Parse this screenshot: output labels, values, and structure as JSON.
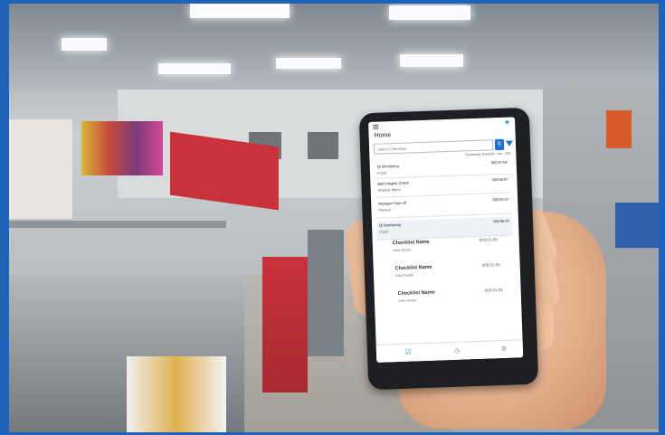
{
  "app": {
    "header_title": "Home",
    "search_placeholder": "Search Checklists",
    "remaining_text": "Remaining Time(HH : mm : SS)",
    "tasks": [
      {
        "name": "QI Monitoring",
        "time": "000:07:08",
        "area": "Foyer"
      },
      {
        "name": "Bell Integrity Check",
        "time": "000:08:07",
        "area": "Regular Menu"
      },
      {
        "name": "Manager Sign-off",
        "time": "000:08:47",
        "area": "Manual"
      },
      {
        "name": "QI Monitoring",
        "time": "000:08:47",
        "area": "Foyer"
      }
    ],
    "checklists": [
      {
        "name": "Checklist Name",
        "area": "Area Name",
        "time": "000:01:05"
      },
      {
        "name": "Checklist Name",
        "area": "Area Name",
        "time": "000:01:05"
      },
      {
        "name": "Checklist Name",
        "area": "Area Name",
        "time": "000:01:05"
      }
    ]
  },
  "colors": {
    "frame_border": "#1f63b8",
    "accent": "#1e6fd9"
  }
}
